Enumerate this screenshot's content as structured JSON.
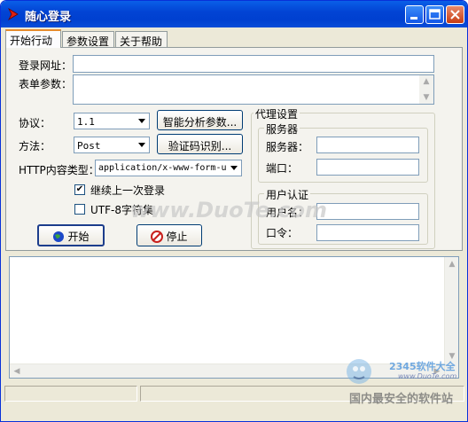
{
  "window": {
    "title": "随心登录"
  },
  "tabs": [
    {
      "label": "开始行动"
    },
    {
      "label": "参数设置"
    },
    {
      "label": "关于帮助"
    }
  ],
  "form": {
    "url_label": "登录网址：",
    "url_value": "",
    "params_label": "表单参数：",
    "params_value": "",
    "protocol_label": "协议：",
    "protocol_value": "1.1",
    "method_label": "方法：",
    "method_value": "Post",
    "content_type_label": "HTTP内容类型：",
    "content_type_value": "application/x-www-form-u",
    "smart_button": "智能分析参数...",
    "captcha_button": "验证码识别...",
    "continue_label": "继续上一次登录",
    "continue_checked": true,
    "utf8_label": "UTF-8字符集",
    "utf8_checked": false,
    "start_button": "开始",
    "stop_button": "停止"
  },
  "proxy": {
    "group_title": "代理设置",
    "server_group": "服务器",
    "server_label": "服务器：",
    "port_label": "端口：",
    "auth_group": "用户认证",
    "user_label": "用户名：",
    "password_label": "口令："
  },
  "watermark": {
    "duote": "www.DuoTe.com",
    "brand": "2345软件大全",
    "site": "www.DuoTe.com",
    "slogan": "国内最安全的软件站"
  }
}
